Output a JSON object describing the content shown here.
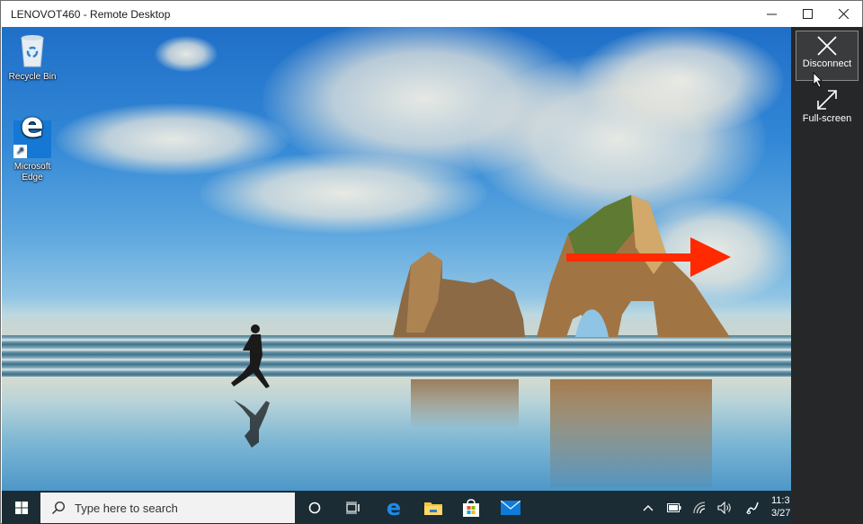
{
  "window": {
    "title": "LENOVOT460 - Remote Desktop",
    "controls": [
      "minimize",
      "maximize",
      "close"
    ]
  },
  "desktop": {
    "icons": [
      {
        "label": "Recycle Bin",
        "icon": "recycle-bin-icon"
      },
      {
        "label": "Microsoft Edge",
        "icon": "edge-icon"
      }
    ],
    "annotation": {
      "type": "arrow",
      "color": "#ff2a00",
      "direction": "right"
    }
  },
  "side_panel": {
    "buttons": [
      {
        "label": "Disconnect",
        "icon": "close-icon",
        "active": true
      },
      {
        "label": "Full-screen",
        "icon": "fullscreen-icon",
        "active": false
      }
    ]
  },
  "taskbar": {
    "search_placeholder": "Type here to search",
    "pinned": [
      "cortana",
      "task-view",
      "edge",
      "file-explorer",
      "microsoft-store",
      "mail"
    ],
    "tray": [
      "show-hidden-icons",
      "battery",
      "wifi",
      "volume",
      "pen"
    ],
    "clock_time": "11:3",
    "clock_date": "3/27"
  },
  "colors": {
    "taskbar": "#1b2c34",
    "side_panel": "#262728",
    "accent": "#0078d7",
    "arrow": "#ff2a00"
  }
}
